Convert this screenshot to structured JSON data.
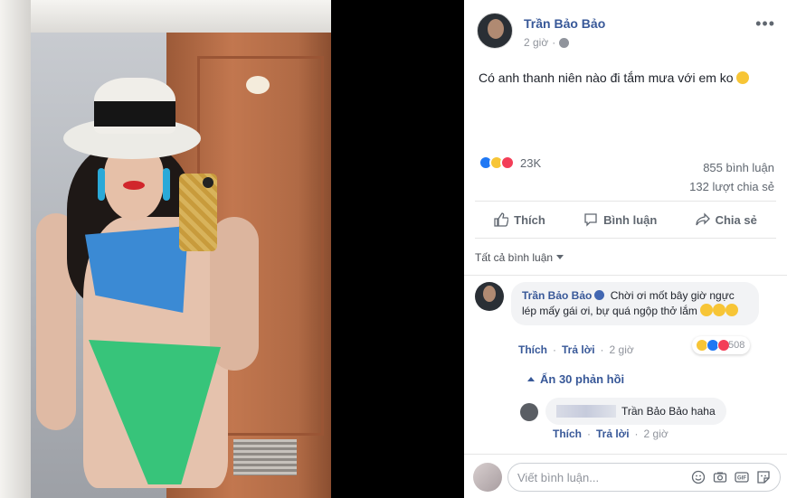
{
  "post": {
    "author": "Trần Bảo Bảo",
    "time": "2 giờ",
    "text": "Có anh thanh niên nào đi tắm mưa với em ko",
    "reaction_count": "23K",
    "comment_count": "855 bình luận",
    "share_count": "132 lượt chia sẻ"
  },
  "actions": {
    "like": "Thích",
    "comment": "Bình luận",
    "share": "Chia sẻ"
  },
  "comments": {
    "sort_label": "Tất cả bình luận",
    "top": {
      "author": "Trần Bảo Bảo",
      "text": "Chời ơi mốt bây giờ ngực lép mấy gái ơi, bự quá ngộp thở lắm",
      "like": "Thích",
      "reply": "Trả lời",
      "time": "2 giờ",
      "reaction_count": "508"
    },
    "hide_replies": "Ẩn 30 phản hồi",
    "reply": {
      "text": "Trần Bảo Bảo haha",
      "like": "Thích",
      "reply": "Trả lời",
      "time": "2 giờ"
    },
    "write_placeholder": "Viết bình luận..."
  },
  "colors": {
    "link": "#385898",
    "like_blue": "#2078f4",
    "love_red": "#f33e58",
    "haha_yellow": "#f7c536"
  },
  "icons": [
    "more-icon",
    "globe-icon",
    "like-icon",
    "comment-icon",
    "share-icon",
    "emoji-icon",
    "camera-icon",
    "gif-icon",
    "sticker-icon",
    "verified-icon"
  ]
}
